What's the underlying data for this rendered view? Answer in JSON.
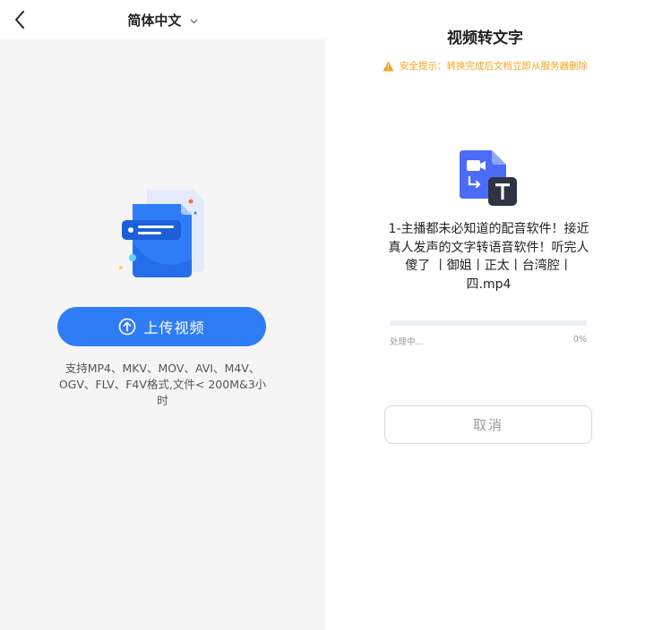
{
  "left_panel": {
    "language_selector": {
      "label": "简体中文"
    },
    "upload_button": {
      "label": "上传视频"
    },
    "support_text": "支持MP4、MKV、MOV、AVI、M4V、OGV、FLV、F4V格式,文件< 200M&3小时"
  },
  "right_panel": {
    "title": "视频转文字",
    "safety_notice": "安全提示：转换完成后文档立即从服务器删除",
    "file_name": "1-主播都未必知道的配音软件！接近真人发声的文字转语音软件！听完人傻了 丨御姐丨正太丨台湾腔丨四.mp4",
    "progress": {
      "status": "处理中...",
      "percent_label": "0%",
      "value": 0
    },
    "cancel_button": {
      "label": "取消"
    }
  },
  "colors": {
    "accent": "#2f7df6",
    "warning": "#f5a21b",
    "panel_background": "#f5f5f5",
    "file_icon_dark": "#2e3444",
    "file_icon_blue": "#4a6cf7"
  },
  "icons": {
    "back": "chevron-left-icon",
    "language_dropdown": "chevron-down-icon",
    "upload": "arrow-up-circle-icon",
    "warning": "warning-triangle-icon",
    "file": "video-to-text-file-icon"
  }
}
